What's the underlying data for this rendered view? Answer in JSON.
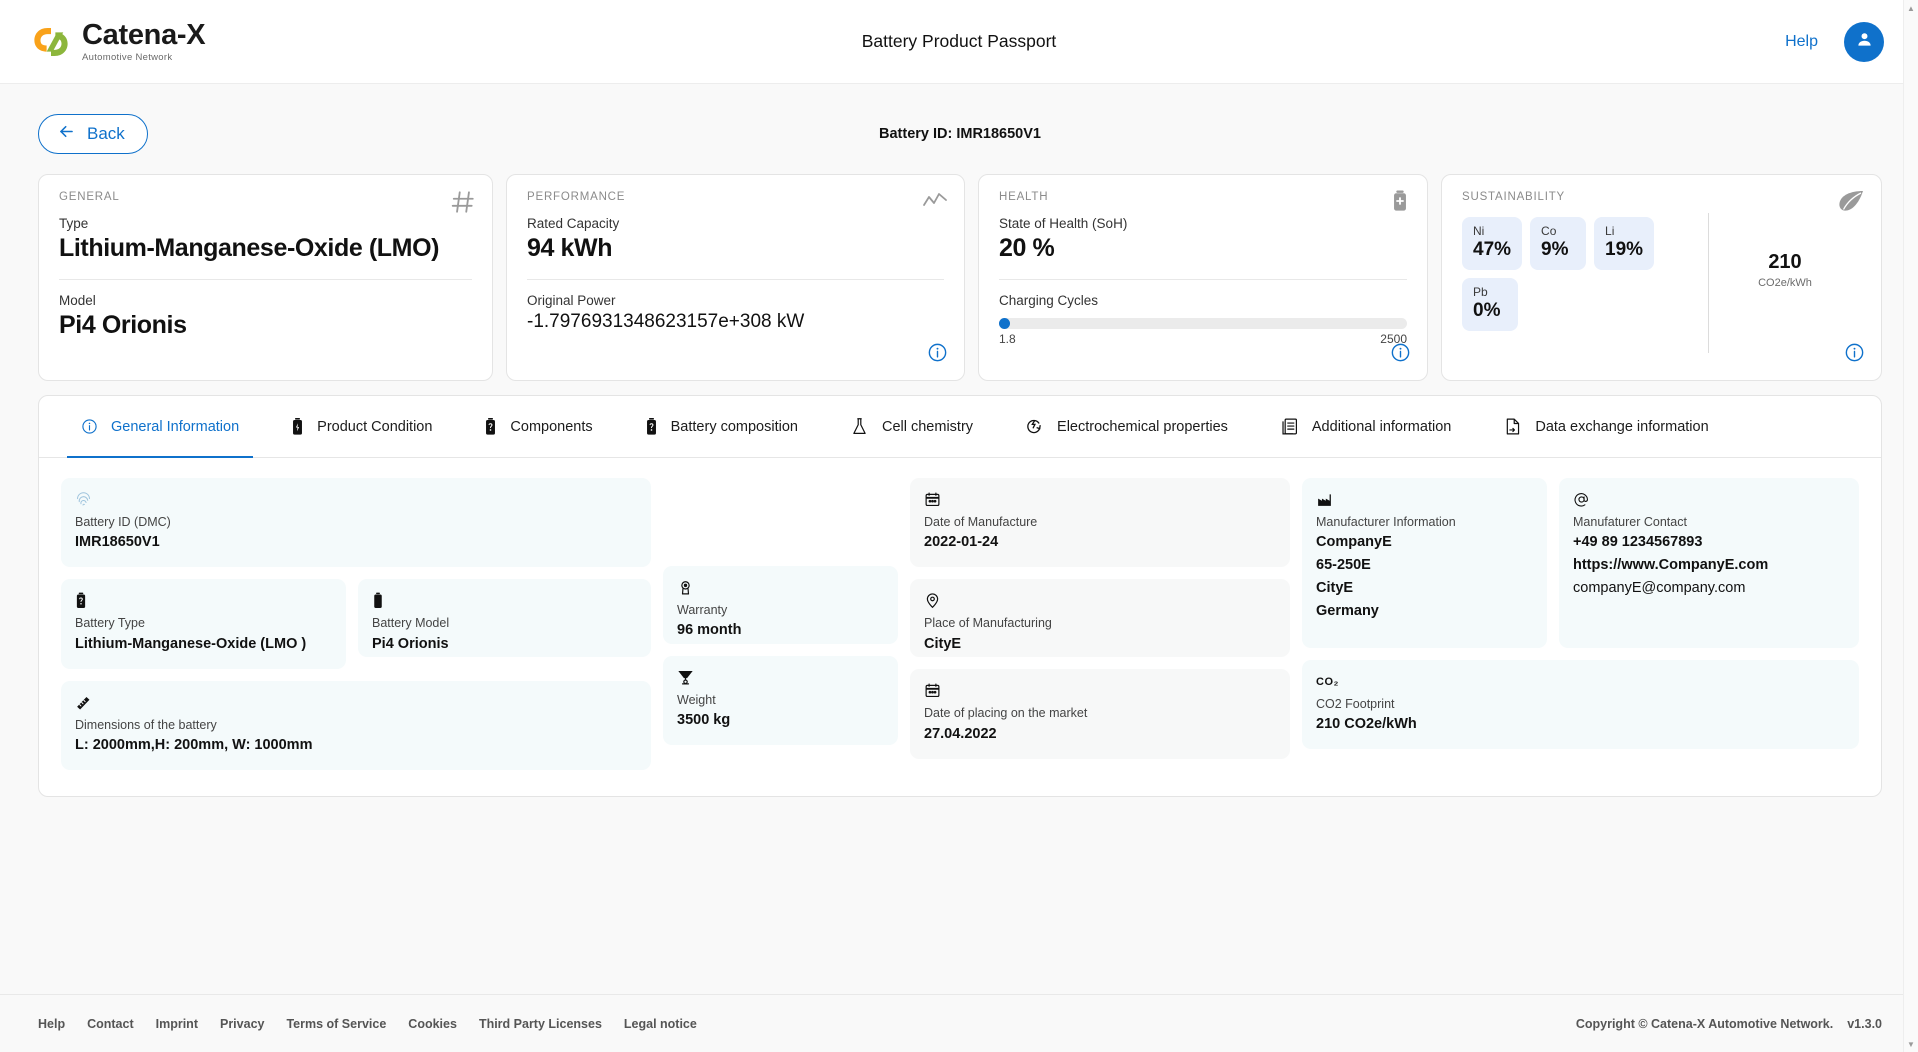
{
  "header": {
    "logo_name": "Catena-X",
    "logo_sub": "Automotive Network",
    "title": "Battery Product Passport",
    "help_label": "Help",
    "avatar_icon": "user-icon"
  },
  "topbar": {
    "back_label": "Back",
    "battery_id_text": "Battery ID: IMR18650V1"
  },
  "cards": {
    "general": {
      "title": "GENERAL",
      "icon": "hash-icon",
      "rows": [
        {
          "label": "Type",
          "value": "Lithium-Manganese-Oxide (LMO)"
        },
        {
          "label": "Model",
          "value": "Pi4 Orionis"
        }
      ]
    },
    "performance": {
      "title": "PERFORMANCE",
      "icon": "trend-line-icon",
      "rows": [
        {
          "label": "Rated Capacity",
          "value": "94 kWh"
        },
        {
          "label": "Original Power",
          "value": "-1.7976931348623157e+308 kW"
        }
      ],
      "info_icon": "info-icon"
    },
    "health": {
      "title": "HEALTH",
      "icon": "battery-plus-icon",
      "soh_label": "State of Health (SoH)",
      "soh_value": "20 %",
      "cycles_label": "Charging Cycles",
      "cycles_min": "1.8",
      "cycles_max": "2500",
      "cycles_fill_percent": 2,
      "bar_color": "#0f71cb",
      "info_icon": "info-icon"
    },
    "sustainability": {
      "title": "SUSTAINABILITY",
      "icon": "leaf-icon",
      "chips": [
        {
          "symbol": "Ni",
          "value": "47%"
        },
        {
          "symbol": "Co",
          "value": "9%"
        },
        {
          "symbol": "Li",
          "value": "19%"
        },
        {
          "symbol": "Pb",
          "value": "0%"
        }
      ],
      "co2_value": "210",
      "co2_unit": "CO2e/kWh",
      "info_icon": "info-icon"
    }
  },
  "tabs": [
    {
      "label": "General Information",
      "icon": "info-circle-icon",
      "active": true
    },
    {
      "label": "Product Condition",
      "icon": "battery-bolt-icon",
      "active": false
    },
    {
      "label": "Components",
      "icon": "battery-question-icon",
      "active": false
    },
    {
      "label": "Battery composition",
      "icon": "battery-question-icon",
      "active": false
    },
    {
      "label": "Cell chemistry",
      "icon": "flask-icon",
      "active": false
    },
    {
      "label": "Electrochemical properties",
      "icon": "electro-icon",
      "active": false
    },
    {
      "label": "Additional information",
      "icon": "document-list-icon",
      "active": false
    },
    {
      "label": "Data exchange information",
      "icon": "document-exchange-icon",
      "active": false
    }
  ],
  "fields": {
    "battery_id_dmc": {
      "icon": "fingerprint-icon",
      "label": "Battery ID (DMC)",
      "value": "IMR18650V1"
    },
    "battery_type": {
      "icon": "battery-question-icon",
      "label": "Battery Type",
      "value": "Lithium-Manganese-Oxide (LMO )"
    },
    "battery_model": {
      "icon": "battery-icon",
      "label": "Battery Model",
      "value": "Pi4 Orionis"
    },
    "dimensions": {
      "icon": "ruler-icon",
      "label": "Dimensions of the battery",
      "value": "L: 2000mm,H: 200mm, W: 1000mm"
    },
    "warranty": {
      "icon": "warranty-icon",
      "label": "Warranty",
      "value": "96 month"
    },
    "weight": {
      "icon": "weight-icon",
      "label": "Weight",
      "value": "3500 kg"
    },
    "date_of_manufacture": {
      "icon": "calendar-icon",
      "label": "Date of Manufacture",
      "value": "2022-01-24"
    },
    "place_of_manufacturing": {
      "icon": "map-pin-icon",
      "label": "Place of Manufacturing",
      "value": "CityE"
    },
    "date_placing_market": {
      "icon": "calendar-icon",
      "label": "Date of placing on the market",
      "value": "27.04.2022"
    },
    "manufacturer_information": {
      "icon": "factory-icon",
      "label": "Manufacturer Information",
      "lines": [
        "CompanyE",
        "65-250E",
        "CityE",
        "Germany"
      ]
    },
    "manufacturer_contact": {
      "icon": "at-icon",
      "label": "Manufaturer Contact",
      "lines": [
        "+49 89 1234567893",
        "https://www.CompanyE.com",
        "companyE@company.com"
      ]
    },
    "co2_footprint": {
      "icon": "co2-icon",
      "label": "CO2 Footprint",
      "value": "210 CO2e/kWh"
    }
  },
  "footer": {
    "links": [
      "Help",
      "Contact",
      "Imprint",
      "Privacy",
      "Terms of Service",
      "Cookies",
      "Third Party Licenses",
      "Legal notice"
    ],
    "copyright": "Copyright © Catena-X Automotive Network.",
    "version": "v1.3.0"
  }
}
